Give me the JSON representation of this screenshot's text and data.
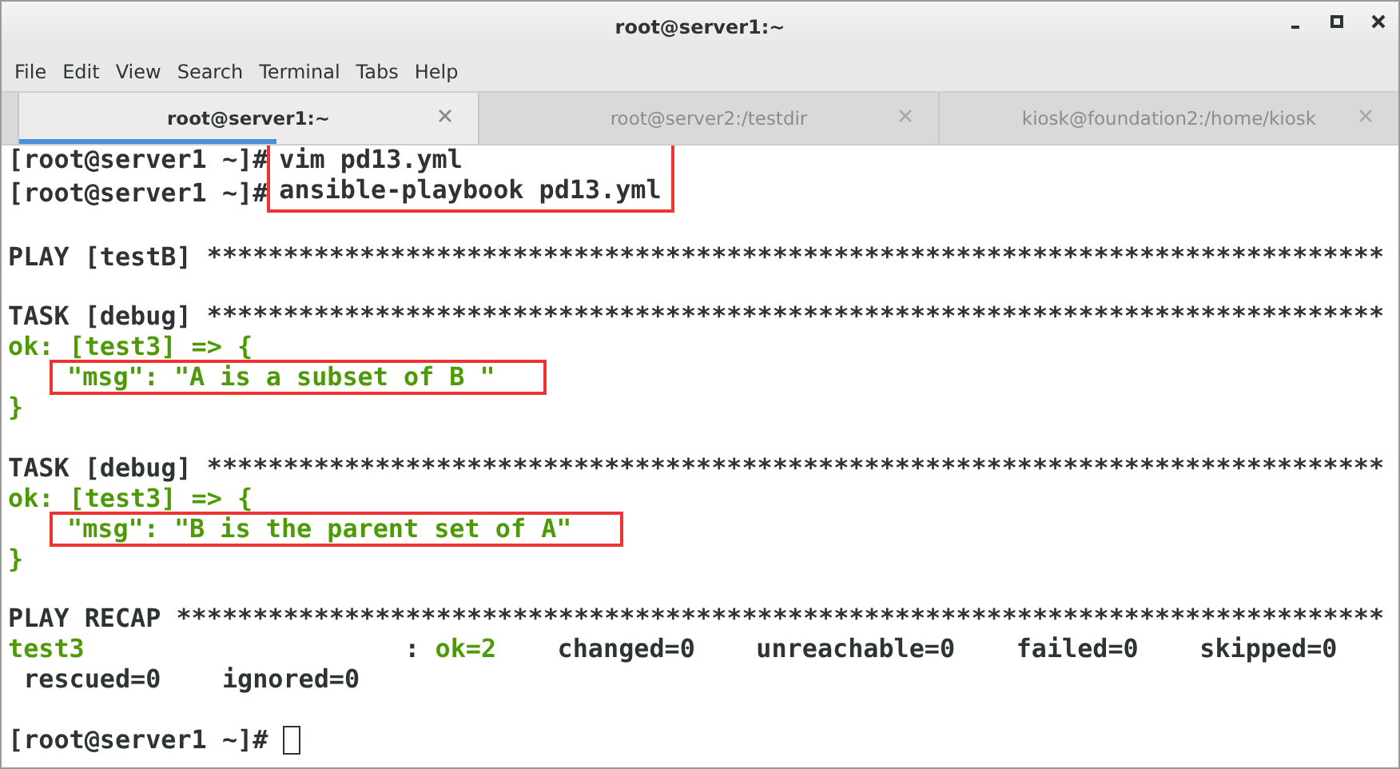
{
  "window": {
    "title": "root@server1:~"
  },
  "menu": [
    "File",
    "Edit",
    "View",
    "Search",
    "Terminal",
    "Tabs",
    "Help"
  ],
  "tabs": [
    {
      "label": "root@server1:~",
      "selected": true
    },
    {
      "label": "root@server2:/testdir",
      "selected": false
    },
    {
      "label": "kiosk@foundation2:/home/kiosk",
      "selected": false
    }
  ],
  "terminal": [
    {
      "kind": "commands",
      "boxed": true,
      "lines": [
        {
          "prompt": "[root@server1 ~]#",
          "command": "vim pd13.yml"
        },
        {
          "prompt": "[root@server1 ~]#",
          "command": "ansible-playbook pd13.yml"
        }
      ]
    },
    {
      "kind": "blank"
    },
    {
      "kind": "header",
      "text": "PLAY [testB] *****************************************************************************"
    },
    {
      "kind": "blank"
    },
    {
      "kind": "header",
      "text": "TASK [debug] *****************************************************************************"
    },
    {
      "kind": "ok",
      "text": "ok: [test3] => {"
    },
    {
      "kind": "msg",
      "boxed": true,
      "text": "\"msg\": \"A is a subset of B \""
    },
    {
      "kind": "ok",
      "text": "}"
    },
    {
      "kind": "blank"
    },
    {
      "kind": "header",
      "text": "TASK [debug] *****************************************************************************"
    },
    {
      "kind": "ok",
      "text": "ok: [test3] => {"
    },
    {
      "kind": "msg",
      "boxed": true,
      "text": "\"msg\": \"B is the parent set of A\""
    },
    {
      "kind": "ok",
      "text": "}"
    },
    {
      "kind": "blank"
    },
    {
      "kind": "header",
      "text": "PLAY RECAP *******************************************************************************"
    },
    {
      "kind": "recap",
      "host": "test3",
      "separator": ":",
      "ok": "ok=2",
      "stats": [
        "changed=0",
        "unreachable=0",
        "failed=0",
        "skipped=0"
      ]
    },
    {
      "kind": "stats",
      "stats": [
        "rescued=0",
        "ignored=0"
      ]
    },
    {
      "kind": "blank"
    },
    {
      "kind": "prompt",
      "prompt": "[root@server1 ~]#"
    }
  ]
}
